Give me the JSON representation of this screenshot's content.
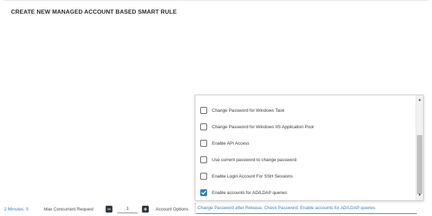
{
  "header": {
    "title": "CREATE NEW MANAGED ACCOUNT BASED SMART RULE"
  },
  "dropdown": {
    "options": [
      {
        "label": "Change Password for Windows Task",
        "checked": false
      },
      {
        "label": "Change Password for Windows IIS Application Pool",
        "checked": false
      },
      {
        "label": "Enable API Access",
        "checked": false
      },
      {
        "label": "Use current password to change password",
        "checked": false
      },
      {
        "label": "Enable Login Account For SSH Sessions",
        "checked": false
      },
      {
        "label": "Enable accounts for AD/LDAP queries",
        "checked": true
      }
    ]
  },
  "footer": {
    "minutes_text": "2 Minutes: 0",
    "max_concurrent_label": "Max Concurrent Request",
    "max_concurrent_value": "1",
    "account_options_label": "Account Options",
    "account_options_value": "Change Password after Release, Check Password, Enable accounts for AD/LDAP queries"
  },
  "colors": {
    "accent": "#2f7fc4",
    "stepper": "#2f3a45"
  }
}
